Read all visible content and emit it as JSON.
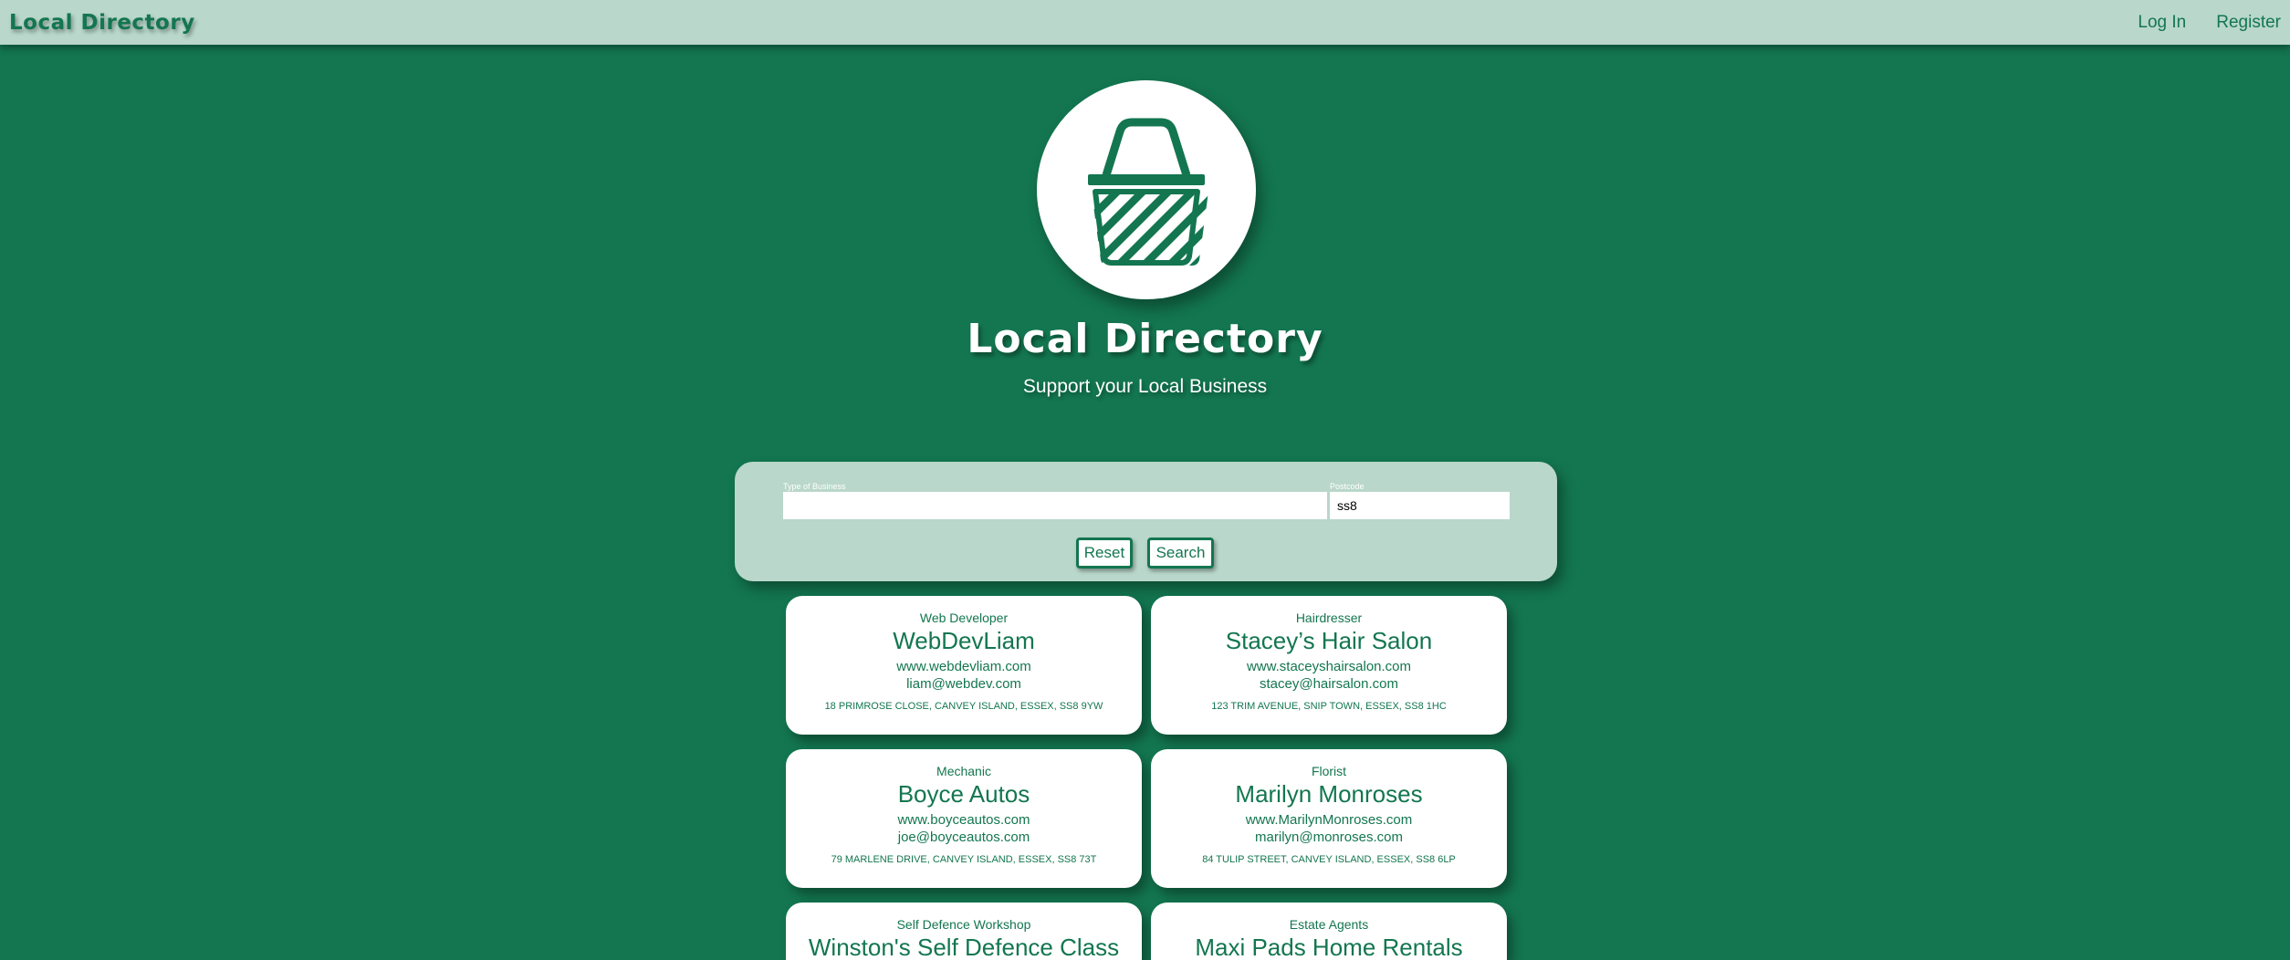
{
  "nav": {
    "brand": "Local Directory",
    "login": "Log In",
    "register": "Register"
  },
  "hero": {
    "logo_icon": "basket-icon",
    "title": "Local Directory",
    "subtitle": "Support your Local Business"
  },
  "search": {
    "type_label": "Type of Business",
    "type_value": "",
    "postcode_label": "Postcode",
    "postcode_value": "ss8",
    "reset_label": "Reset",
    "search_label": "Search"
  },
  "businesses": [
    {
      "category": "Web Developer",
      "name": "WebDevLiam",
      "website": "www.webdevliam.com",
      "email": "liam@webdev.com",
      "address": "18 PRIMROSE CLOSE, CANVEY ISLAND, ESSEX, SS8 9YW"
    },
    {
      "category": "Hairdresser",
      "name": "Stacey’s Hair Salon",
      "website": "www.staceyshairsalon.com",
      "email": "stacey@hairsalon.com",
      "address": "123 TRIM AVENUE, SNIP TOWN, ESSEX, SS8 1HC"
    },
    {
      "category": "Mechanic",
      "name": "Boyce Autos",
      "website": "www.boyceautos.com",
      "email": "joe@boyceautos.com",
      "address": "79 MARLENE DRIVE, CANVEY ISLAND, ESSEX, SS8 73T"
    },
    {
      "category": "Florist",
      "name": "Marilyn Monroses",
      "website": "www.MarilynMonroses.com",
      "email": "marilyn@monroses.com",
      "address": "84 TULIP STREET, CANVEY ISLAND, ESSEX, SS8 6LP"
    },
    {
      "category": "Self Defence Workshop",
      "name": "Winston's Self Defence Class",
      "website": "",
      "email": "",
      "address": ""
    },
    {
      "category": "Estate Agents",
      "name": "Maxi Pads Home Rentals",
      "website": "",
      "email": "",
      "address": ""
    }
  ],
  "colors": {
    "background": "#137650",
    "panel": "#b9d7cb",
    "accent": "#137650",
    "card": "#ffffff"
  }
}
